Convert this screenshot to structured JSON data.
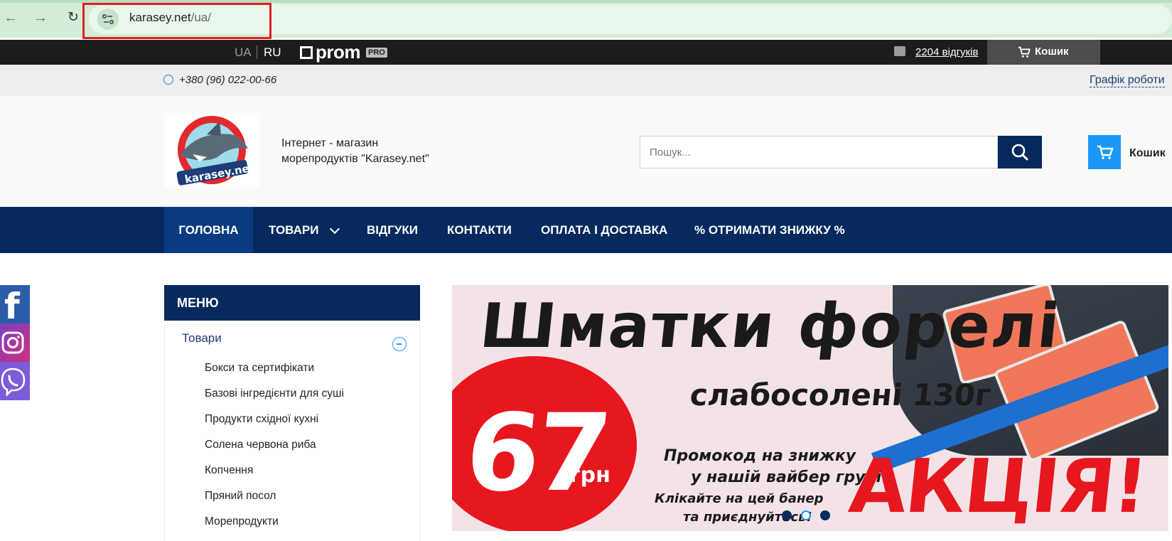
{
  "browser": {
    "url_host": "karasey.net",
    "url_path": "/ua/"
  },
  "topbar": {
    "lang_ua": "UA",
    "lang_ru": "RU",
    "prom_text": "prom",
    "prom_pro": "PRO",
    "reviews": "2204 відгуків",
    "cart": "Кошик"
  },
  "phonebar": {
    "phone": "+380 (96) 022-00-66",
    "schedule": "Графік роботи"
  },
  "header": {
    "store_line1": "Інтернет - магазин",
    "store_line2": "морепродуктів \"Karasey.net\"",
    "search_placeholder": "Пошук...",
    "cart": "Кошик"
  },
  "nav": {
    "items": [
      "ГОЛОВНА",
      "ТОВАРИ",
      "ВІДГУКИ",
      "КОНТАКТИ",
      "ОПЛАТА І ДОСТАВКА",
      "% ОТРИМАТИ ЗНИЖКУ %"
    ]
  },
  "sidebar": {
    "title": "МЕНЮ",
    "category": "Товари",
    "subcategories": [
      "Бокси та сертифікати",
      "Базові інгредієнти для суші",
      "Продукти східної кухні",
      "Солена червона риба",
      "Копчення",
      "Пряний посол",
      "Морепродукти"
    ]
  },
  "banner": {
    "title": "Шматки форелі",
    "subtitle": "слабосолені 130г",
    "price": "67",
    "price_unit": "грн",
    "promo_line1": "Промокод на знижку",
    "promo_line2": "у нашій вайбер групі!",
    "promo_line3": "Клікайте на цей банер",
    "promo_line4": "та приєднуйтесь!",
    "sale": "АКЦІЯ!",
    "slides_total": 3,
    "active_slide": 2
  },
  "colors": {
    "navy": "#062a5e",
    "accent_blue": "#1b98f5",
    "sale_red": "#e7171f"
  }
}
